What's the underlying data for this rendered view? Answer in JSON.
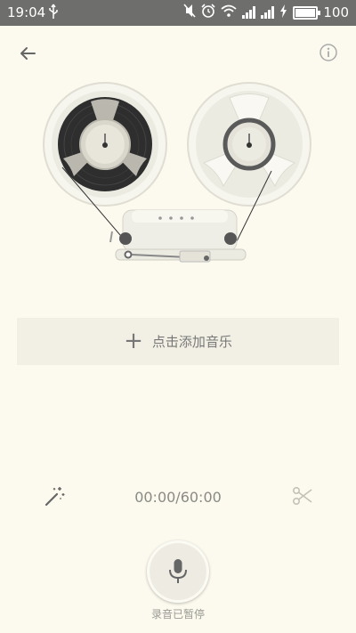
{
  "status_bar": {
    "time": "19:04",
    "battery_level": "100",
    "network_label": "4G"
  },
  "header": {
    "back_icon": "arrow-left-icon",
    "info_icon": "info-icon"
  },
  "add_music": {
    "icon": "plus-icon",
    "label": "点击添加音乐"
  },
  "controls": {
    "effects_icon": "magic-wand-icon",
    "timer": "00:00/60:00",
    "trim_icon": "scissors-icon"
  },
  "record": {
    "icon": "microphone-icon",
    "status": "录音已暂停"
  },
  "colors": {
    "background": "#fcfaee",
    "status_bar": "#6e6e6c",
    "panel": "#f2f0e4",
    "tape": "#2e2e2e"
  }
}
